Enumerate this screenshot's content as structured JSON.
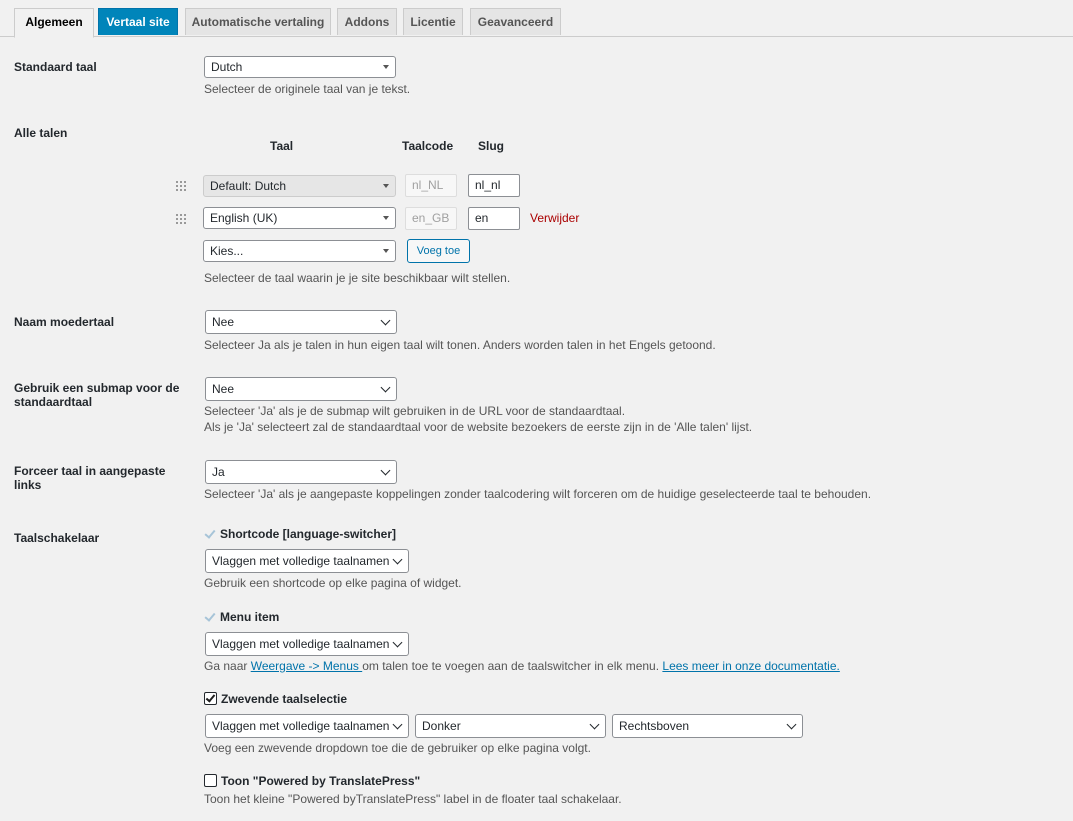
{
  "tabs": [
    "Algemeen",
    "Vertaal site",
    "Automatische vertaling",
    "Addons",
    "Licentie",
    "Geavanceerd"
  ],
  "default_language": {
    "label": "Standaard taal",
    "value": "Dutch",
    "description": "Selecteer de originele taal van je tekst."
  },
  "all_languages": {
    "label": "Alle talen",
    "col_language": "Taal",
    "col_code": "Taalcode",
    "col_slug": "Slug",
    "rows": [
      {
        "language": "Default: Dutch",
        "code": "nl_NL",
        "slug": "nl_nl"
      },
      {
        "language": "English (UK)",
        "code": "en_GB",
        "slug": "en",
        "remove": "Verwijder"
      }
    ],
    "choose_placeholder": "Kies...",
    "add_button": "Voeg toe",
    "description": "Selecteer de taal waarin je je site beschikbaar wilt stellen."
  },
  "native_name": {
    "label": "Naam moedertaal",
    "value": "Nee",
    "description": "Selecteer Ja als je talen in hun eigen taal wilt tonen. Anders worden talen in het Engels getoond."
  },
  "subdirectory": {
    "label_line1": "Gebruik een submap voor de",
    "label_line2": "standaardtaal",
    "value": "Nee",
    "description_line1": "Selecteer 'Ja' als je de submap wilt gebruiken in de URL voor de standaardtaal.",
    "description_line2": "Als je 'Ja' selecteert zal de standaardtaal voor de website bezoekers de eerste zijn in de 'Alle talen' lijst."
  },
  "force_language": {
    "label_line1": "Forceer taal in aangepaste",
    "label_line2": "links",
    "value": "Ja",
    "description": "Selecteer 'Ja' als je aangepaste koppelingen zonder taalcodering wilt forceren om de huidige geselecteerde taal te behouden."
  },
  "switcher": {
    "label": "Taalschakelaar",
    "shortcode": {
      "label": "Shortcode [language-switcher]",
      "select": "Vlaggen met volledige taalnamen",
      "description": "Gebruik een shortcode op elke pagina of widget."
    },
    "menu": {
      "label": "Menu item",
      "select": "Vlaggen met volledige taalnamen",
      "desc_before": "Ga naar ",
      "desc_link1": "Weergave -> Menus ",
      "desc_middle": "om talen toe te voegen aan de taalswitcher in elk menu. ",
      "desc_link2": "Lees meer in onze documentatie."
    },
    "floating": {
      "label": "Zwevende taalselectie",
      "select": "Vlaggen met volledige taalnamen",
      "theme": "Donker",
      "position": "Rechtsboven",
      "description": "Voeg een zwevende dropdown toe die de gebruiker op elke pagina volgt."
    },
    "powered": {
      "label": "Toon \"Powered by TranslatePress\"",
      "description": "Toon het kleine \"Powered byTranslatePress\" label in de floater taal schakelaar."
    }
  }
}
